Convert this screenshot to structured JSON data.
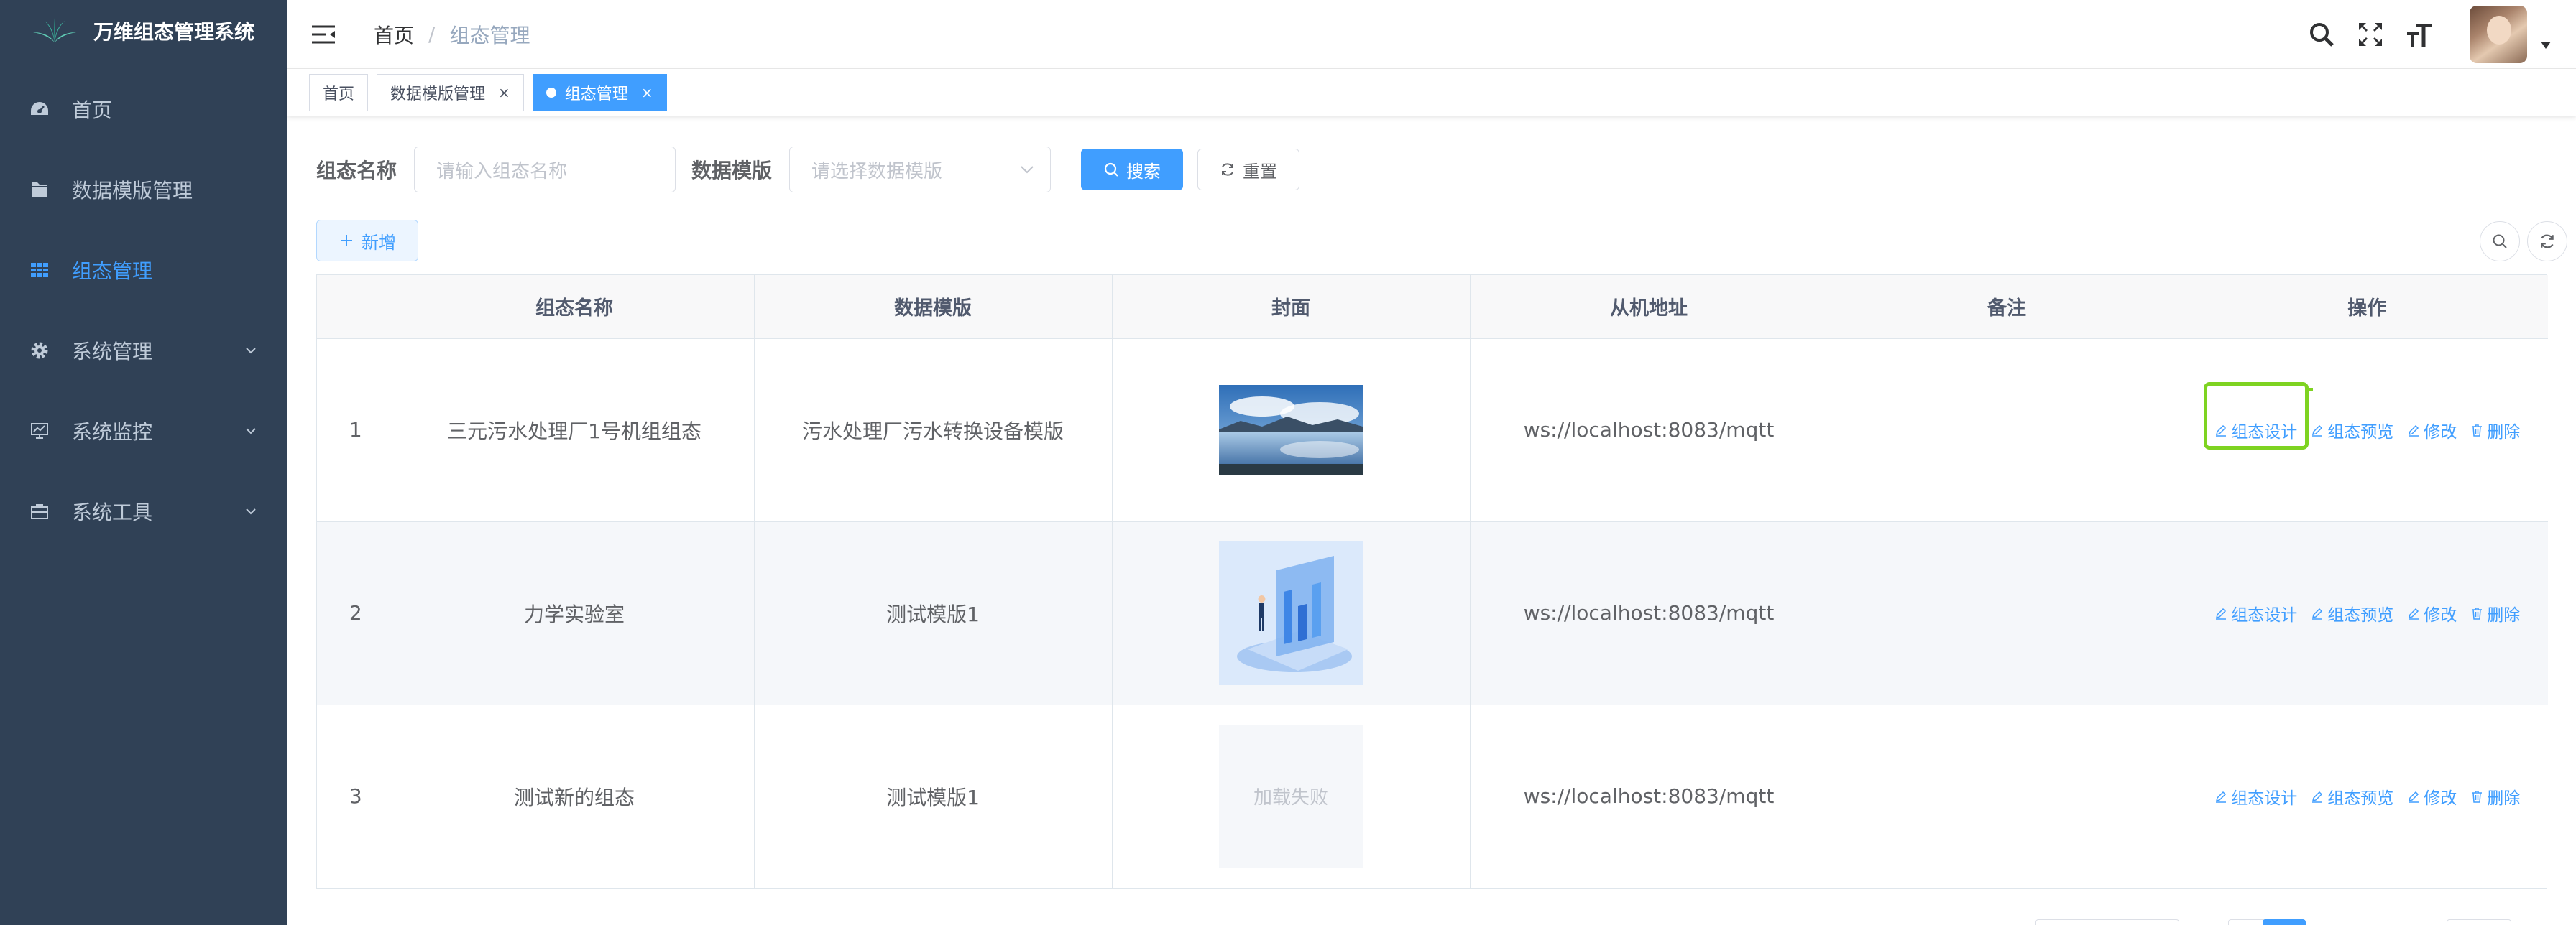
{
  "app": {
    "title": "万维组态管理系统"
  },
  "sidebar": {
    "items": [
      {
        "label": "首页",
        "icon": "dashboard-icon"
      },
      {
        "label": "数据模版管理",
        "icon": "folder-icon"
      },
      {
        "label": "组态管理",
        "icon": "grid-icon",
        "active": true
      },
      {
        "label": "系统管理",
        "icon": "gear-icon",
        "expandable": true
      },
      {
        "label": "系统监控",
        "icon": "monitor-icon",
        "expandable": true
      },
      {
        "label": "系统工具",
        "icon": "toolbox-icon",
        "expandable": true
      }
    ]
  },
  "header": {
    "breadcrumb": {
      "home": "首页",
      "separator": "/",
      "current": "组态管理"
    },
    "icons": [
      "search-icon",
      "fullscreen-icon",
      "font-size-icon"
    ]
  },
  "tags": [
    {
      "label": "首页"
    },
    {
      "label": "数据模版管理",
      "close": "×"
    },
    {
      "label": "组态管理",
      "close": "×",
      "active": true
    }
  ],
  "search": {
    "name_label": "组态名称",
    "name_placeholder": "请输入组态名称",
    "template_label": "数据模版",
    "template_placeholder": "请选择数据模版",
    "search_button": "搜索",
    "reset_button": "重置"
  },
  "toolbar": {
    "add_button": "新增"
  },
  "table": {
    "headers": [
      "",
      "组态名称",
      "数据模版",
      "封面",
      "从机地址",
      "备注",
      "操作"
    ],
    "rows": [
      {
        "index": "1",
        "name": "三元污水处理厂1号机组组态",
        "template": "污水处理厂污水转换设备模版",
        "cover": "landscape-image",
        "address": "ws://localhost:8083/mqtt",
        "remark": ""
      },
      {
        "index": "2",
        "name": "力学实验室",
        "template": "测试模版1",
        "cover": "isometric-chart-image",
        "address": "ws://localhost:8083/mqtt",
        "remark": ""
      },
      {
        "index": "3",
        "name": "测试新的组态",
        "template": "测试模版1",
        "cover": "load-failed",
        "cover_text": "加载失败",
        "address": "ws://localhost:8083/mqtt",
        "remark": ""
      }
    ],
    "actions": {
      "design": "组态设计",
      "preview": "组态预览",
      "edit": "修改",
      "delete": "删除"
    }
  },
  "colors": {
    "sidebar_bg": "#304156",
    "accent": "#409eff",
    "highlight": "#7ed321"
  }
}
